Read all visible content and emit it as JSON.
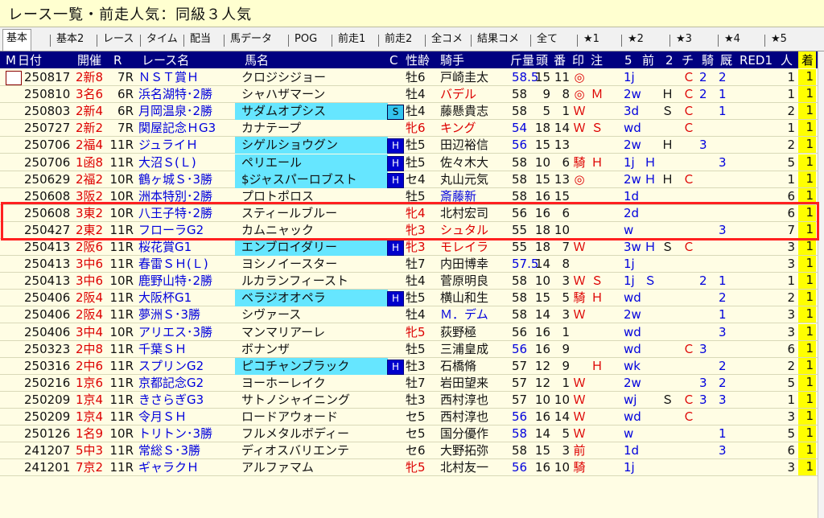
{
  "title": "レース一覧・前走人気：同級３人気",
  "tabs": [
    "基本",
    "基本2",
    "レース",
    "タイム",
    "配当",
    "馬データ",
    "POG",
    "前走1",
    "前走2",
    "全コメ",
    "結果コメ",
    "全て",
    "★1",
    "★2",
    "★3",
    "★4",
    "★5"
  ],
  "columns": {
    "m": "M",
    "date": "日付",
    "venue": "開催",
    "race_no": "R",
    "race_name": "レース名",
    "horse": "馬名",
    "c": "C",
    "sex_age": "性齢",
    "jockey": "騎手",
    "weight": "斤量",
    "heads": "頭",
    "gate": "番",
    "mark": "印",
    "note": "注",
    "col5": "5",
    "prev": "前",
    "col2": "2",
    "chi": "チ",
    "ki": "騎",
    "kyu": "厩",
    "red": "RED1",
    "pop": "人",
    "finish": "着"
  },
  "rows": [
    {
      "date": "250817",
      "venue": "2新8",
      "r": "7R",
      "race": "ＮＳＴ賞Ｈ",
      "horse": "クロジシジョー",
      "badge": "",
      "sex": "牡6",
      "sex_red": false,
      "jockey": "戸崎圭太",
      "w": "58.5",
      "w_blue": true,
      "heads": "15",
      "gate": "11",
      "mark": "◎",
      "note": "",
      "c5": "1j",
      "prev": "",
      "c2": "",
      "chi": "Ｃ",
      "ki": "2",
      "kyu": "2",
      "pop": "1",
      "fin": "1",
      "horse_cyan": false
    },
    {
      "date": "250810",
      "venue": "3名6",
      "r": "6R",
      "race": "浜名湖特･2勝",
      "horse": "シャハザマーン",
      "badge": "",
      "sex": "牡4",
      "sex_red": false,
      "jockey": "バデル",
      "w": "58",
      "w_blue": false,
      "heads": "9",
      "gate": "8",
      "mark": "◎",
      "note": "Ｍ",
      "c5": "2w",
      "prev": "",
      "c2": "Ｈ",
      "chi": "Ｃ",
      "ki": "2",
      "kyu": "1",
      "pop": "1",
      "fin": "1",
      "horse_cyan": false,
      "jockey_red": true
    },
    {
      "date": "250803",
      "venue": "2新4",
      "r": "6R",
      "race": "月岡温泉･2勝",
      "horse": "サダムオプシス",
      "badge": "S",
      "sex": "牡4",
      "sex_red": false,
      "jockey": "藤懸貴志",
      "w": "58",
      "w_blue": false,
      "heads": "5",
      "gate": "1",
      "mark": "Ｗ",
      "note": "",
      "c5": "3d",
      "prev": "",
      "c2": "Ｓ",
      "chi": "Ｃ",
      "ki": "",
      "kyu": "1",
      "pop": "2",
      "fin": "1",
      "horse_cyan": true
    },
    {
      "date": "250727",
      "venue": "2新2",
      "r": "7R",
      "race": "関屋記念ＨG3",
      "horse": "カナテープ",
      "badge": "",
      "sex": "牝6",
      "sex_red": true,
      "jockey": "キング",
      "w": "54",
      "w_blue": true,
      "heads": "18",
      "gate": "14",
      "mark": "Ｗ",
      "note": "Ｓ",
      "c5": "wd",
      "prev": "",
      "c2": "",
      "chi": "Ｃ",
      "ki": "",
      "kyu": "",
      "pop": "1",
      "fin": "1",
      "horse_cyan": false,
      "jockey_red": true
    },
    {
      "date": "250706",
      "venue": "2福4",
      "r": "11R",
      "race": "ジュライＨ",
      "horse": "シゲルショウグン",
      "badge": "H",
      "sex": "牡5",
      "sex_red": false,
      "jockey": "田辺裕信",
      "w": "56",
      "w_blue": true,
      "heads": "15",
      "gate": "13",
      "mark": "",
      "note": "",
      "c5": "2w",
      "prev": "",
      "c2": "Ｈ",
      "chi": "",
      "ki": "3",
      "kyu": "",
      "pop": "2",
      "fin": "1",
      "horse_cyan": true
    },
    {
      "date": "250706",
      "venue": "1函8",
      "r": "11R",
      "race": "大沼Ｓ(Ｌ)",
      "horse": "ペリエール",
      "badge": "H",
      "sex": "牡5",
      "sex_red": false,
      "jockey": "佐々木大",
      "w": "58",
      "w_blue": false,
      "heads": "10",
      "gate": "6",
      "mark": "騎",
      "note": "Ｈ",
      "c5": "1j",
      "prev": "Ｈ",
      "c2": "",
      "chi": "",
      "ki": "",
      "kyu": "3",
      "pop": "5",
      "fin": "1",
      "horse_cyan": true
    },
    {
      "date": "250629",
      "venue": "2福2",
      "r": "10R",
      "race": "鶴ヶ城Ｓ･3勝",
      "horse": "$ジャスパーロブスト",
      "badge": "H",
      "sex": "セ4",
      "sex_red": false,
      "jockey": "丸山元気",
      "w": "58",
      "w_blue": false,
      "heads": "15",
      "gate": "13",
      "mark": "◎",
      "note": "",
      "c5": "2w",
      "prev": "Ｈ",
      "c2": "Ｈ",
      "chi": "Ｃ",
      "ki": "",
      "kyu": "",
      "pop": "1",
      "fin": "1",
      "horse_cyan": true
    },
    {
      "date": "250608",
      "venue": "3阪2",
      "r": "10R",
      "race": "洲本特別･2勝",
      "horse": "プロトポロス",
      "badge": "",
      "sex": "牡5",
      "sex_red": false,
      "jockey": "斎藤新",
      "w": "58",
      "w_blue": false,
      "heads": "16",
      "gate": "15",
      "mark": "",
      "note": "",
      "c5": "1d",
      "prev": "",
      "c2": "",
      "chi": "",
      "ki": "",
      "kyu": "",
      "pop": "6",
      "fin": "1",
      "horse_cyan": false,
      "jockey_blue": true
    },
    {
      "date": "250608",
      "venue": "3東2",
      "r": "10R",
      "race": "八王子特･2勝",
      "horse": "スティールブルー",
      "badge": "",
      "sex": "牝4",
      "sex_red": true,
      "jockey": "北村宏司",
      "w": "56",
      "w_blue": false,
      "heads": "16",
      "gate": "6",
      "mark": "",
      "note": "",
      "c5": "2d",
      "prev": "",
      "c2": "",
      "chi": "",
      "ki": "",
      "kyu": "",
      "pop": "6",
      "fin": "1",
      "horse_cyan": false
    },
    {
      "date": "250427",
      "venue": "2東2",
      "r": "11R",
      "race": "フローラG2",
      "horse": "カムニャック",
      "badge": "",
      "sex": "牝3",
      "sex_red": true,
      "jockey": "シュタル",
      "w": "55",
      "w_blue": false,
      "heads": "18",
      "gate": "10",
      "mark": "",
      "note": "",
      "c5": "w",
      "prev": "",
      "c2": "",
      "chi": "",
      "ki": "",
      "kyu": "3",
      "pop": "7",
      "fin": "1",
      "horse_cyan": false,
      "jockey_red": true
    },
    {
      "date": "250413",
      "venue": "2阪6",
      "r": "11R",
      "race": "桜花賞G1",
      "horse": "エンブロイダリー",
      "badge": "H",
      "sex": "牝3",
      "sex_red": true,
      "jockey": "モレイラ",
      "w": "55",
      "w_blue": false,
      "heads": "18",
      "gate": "7",
      "mark": "Ｗ",
      "note": "",
      "c5": "3w",
      "prev": "Ｈ",
      "c2": "Ｓ",
      "chi": "Ｃ",
      "ki": "",
      "kyu": "",
      "pop": "3",
      "fin": "1",
      "horse_cyan": true,
      "jockey_red": true
    },
    {
      "date": "250413",
      "venue": "3中6",
      "r": "11R",
      "race": "春雷ＳＨ(Ｌ)",
      "horse": "ヨシノイースター",
      "badge": "",
      "sex": "牡7",
      "sex_red": false,
      "jockey": "内田博幸",
      "w": "57.5",
      "w_blue": true,
      "heads": "14",
      "gate": "8",
      "mark": "",
      "note": "",
      "c5": "1j",
      "prev": "",
      "c2": "",
      "chi": "",
      "ki": "",
      "kyu": "",
      "pop": "3",
      "fin": "1",
      "horse_cyan": false
    },
    {
      "date": "250413",
      "venue": "3中6",
      "r": "10R",
      "race": "鹿野山特･2勝",
      "horse": "ルカランフィースト",
      "badge": "",
      "sex": "牡4",
      "sex_red": false,
      "jockey": "菅原明良",
      "w": "58",
      "w_blue": false,
      "heads": "10",
      "gate": "3",
      "mark": "Ｗ",
      "note": "Ｓ",
      "c5": "1j",
      "prev": "Ｓ",
      "c2": "",
      "chi": "",
      "ki": "2",
      "kyu": "1",
      "pop": "1",
      "fin": "1",
      "horse_cyan": false
    },
    {
      "date": "250406",
      "venue": "2阪4",
      "r": "11R",
      "race": "大阪杯G1",
      "horse": "ベラジオオペラ",
      "badge": "H",
      "sex": "牡5",
      "sex_red": false,
      "jockey": "横山和生",
      "w": "58",
      "w_blue": false,
      "heads": "15",
      "gate": "5",
      "mark": "騎",
      "note": "Ｈ",
      "c5": "wd",
      "prev": "",
      "c2": "",
      "chi": "",
      "ki": "",
      "kyu": "2",
      "pop": "2",
      "fin": "1",
      "horse_cyan": true
    },
    {
      "date": "250406",
      "venue": "2阪4",
      "r": "11R",
      "race": "夢洲Ｓ･3勝",
      "horse": "シヴァース",
      "badge": "",
      "sex": "牡4",
      "sex_red": false,
      "jockey": "Ｍ．デム",
      "w": "58",
      "w_blue": false,
      "heads": "14",
      "gate": "3",
      "mark": "Ｗ",
      "note": "",
      "c5": "2w",
      "prev": "",
      "c2": "",
      "chi": "",
      "ki": "",
      "kyu": "1",
      "pop": "3",
      "fin": "1",
      "horse_cyan": false,
      "jockey_blue": true
    },
    {
      "date": "250406",
      "venue": "3中4",
      "r": "10R",
      "race": "アリエス･3勝",
      "horse": "マンマリアーレ",
      "badge": "",
      "sex": "牝5",
      "sex_red": true,
      "jockey": "荻野極",
      "w": "56",
      "w_blue": false,
      "heads": "16",
      "gate": "1",
      "mark": "",
      "note": "",
      "c5": "wd",
      "prev": "",
      "c2": "",
      "chi": "",
      "ki": "",
      "kyu": "3",
      "pop": "3",
      "fin": "1",
      "horse_cyan": false
    },
    {
      "date": "250323",
      "venue": "2中8",
      "r": "11R",
      "race": "千葉ＳＨ",
      "horse": "ボナンザ",
      "badge": "",
      "sex": "牡5",
      "sex_red": false,
      "jockey": "三浦皇成",
      "w": "56",
      "w_blue": true,
      "heads": "16",
      "gate": "9",
      "mark": "",
      "note": "",
      "c5": "wd",
      "prev": "",
      "c2": "",
      "chi": "Ｃ",
      "ki": "3",
      "kyu": "",
      "pop": "6",
      "fin": "1",
      "horse_cyan": false
    },
    {
      "date": "250316",
      "venue": "2中6",
      "r": "11R",
      "race": "スプリンG2",
      "horse": "ピコチャンブラック",
      "badge": "H",
      "sex": "牡3",
      "sex_red": false,
      "jockey": "石橋脩",
      "w": "57",
      "w_blue": false,
      "heads": "12",
      "gate": "9",
      "mark": "",
      "note": "Ｈ",
      "c5": "wk",
      "prev": "",
      "c2": "",
      "chi": "",
      "ki": "",
      "kyu": "2",
      "pop": "2",
      "fin": "1",
      "horse_cyan": true
    },
    {
      "date": "250216",
      "venue": "1京6",
      "r": "11R",
      "race": "京都記念G2",
      "horse": "ヨーホーレイク",
      "badge": "",
      "sex": "牡7",
      "sex_red": false,
      "jockey": "岩田望来",
      "w": "57",
      "w_blue": false,
      "heads": "12",
      "gate": "1",
      "mark": "Ｗ",
      "note": "",
      "c5": "2w",
      "prev": "",
      "c2": "",
      "chi": "",
      "ki": "3",
      "kyu": "2",
      "pop": "5",
      "fin": "1",
      "horse_cyan": false
    },
    {
      "date": "250209",
      "venue": "1京4",
      "r": "11R",
      "race": "きさらぎG3",
      "horse": "サトノシャイニング",
      "badge": "",
      "sex": "牡3",
      "sex_red": false,
      "jockey": "西村淳也",
      "w": "57",
      "w_blue": false,
      "heads": "10",
      "gate": "10",
      "mark": "Ｗ",
      "note": "",
      "c5": "wj",
      "prev": "",
      "c2": "Ｓ",
      "chi": "Ｃ",
      "ki": "3",
      "kyu": "3",
      "pop": "1",
      "fin": "1",
      "horse_cyan": false
    },
    {
      "date": "250209",
      "venue": "1京4",
      "r": "11R",
      "race": "令月ＳＨ",
      "horse": "ロードアウォード",
      "badge": "",
      "sex": "セ5",
      "sex_red": false,
      "jockey": "西村淳也",
      "w": "56",
      "w_blue": true,
      "heads": "16",
      "gate": "14",
      "mark": "Ｗ",
      "note": "",
      "c5": "wd",
      "prev": "",
      "c2": "",
      "chi": "Ｃ",
      "ki": "",
      "kyu": "",
      "pop": "3",
      "fin": "1",
      "horse_cyan": false
    },
    {
      "date": "250126",
      "venue": "1名9",
      "r": "10R",
      "race": "トリトン･3勝",
      "horse": "フルメタルボディー",
      "badge": "",
      "sex": "セ5",
      "sex_red": false,
      "jockey": "国分優作",
      "w": "58",
      "w_blue": true,
      "heads": "14",
      "gate": "5",
      "mark": "Ｗ",
      "note": "",
      "c5": "w",
      "prev": "",
      "c2": "",
      "chi": "",
      "ki": "",
      "kyu": "1",
      "pop": "5",
      "fin": "1",
      "horse_cyan": false
    },
    {
      "date": "241207",
      "venue": "5中3",
      "r": "11R",
      "race": "常総Ｓ･3勝",
      "horse": "ディオスバリエンテ",
      "badge": "",
      "sex": "セ6",
      "sex_red": false,
      "jockey": "大野拓弥",
      "w": "58",
      "w_blue": false,
      "heads": "15",
      "gate": "3",
      "mark": "前",
      "note": "",
      "c5": "1d",
      "prev": "",
      "c2": "",
      "chi": "",
      "ki": "",
      "kyu": "3",
      "pop": "6",
      "fin": "1",
      "horse_cyan": false
    },
    {
      "date": "241201",
      "venue": "7京2",
      "r": "11R",
      "race": "ギャラクＨ",
      "horse": "アルファマム",
      "badge": "",
      "sex": "牝5",
      "sex_red": true,
      "jockey": "北村友一",
      "w": "56",
      "w_blue": true,
      "heads": "16",
      "gate": "10",
      "mark": "騎",
      "note": "",
      "c5": "1j",
      "prev": "",
      "c2": "",
      "chi": "",
      "ki": "",
      "kyu": "",
      "pop": "3",
      "fin": "1",
      "horse_cyan": false
    }
  ]
}
